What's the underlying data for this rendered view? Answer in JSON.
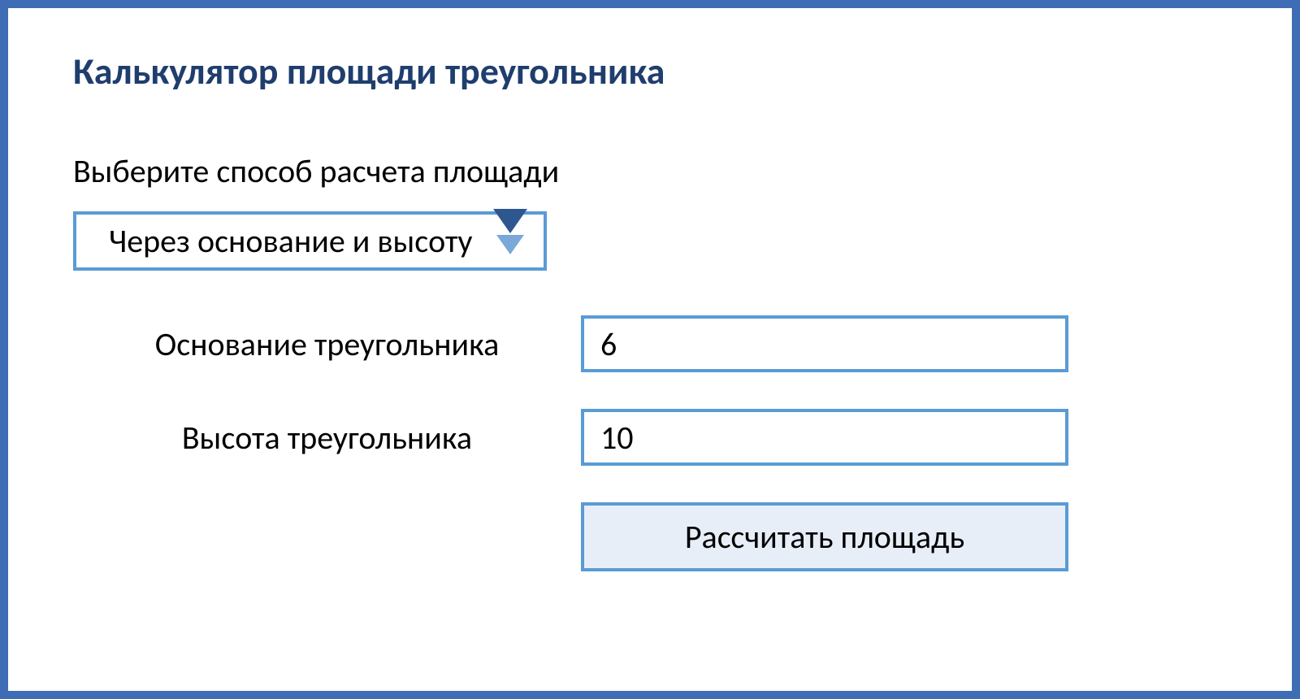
{
  "title": "Калькулятор площади треугольника",
  "method": {
    "label": "Выберите способ расчета площади",
    "selected": "Через основание и высоту"
  },
  "fields": {
    "base": {
      "label": "Основание треугольника",
      "value": "6"
    },
    "height": {
      "label": "Высота треугольника",
      "value": "10"
    }
  },
  "button": {
    "calculate": "Рассчитать площадь"
  },
  "colors": {
    "border": "#3e6db5",
    "accent": "#5a9bd5",
    "titleText": "#1f3e6e",
    "buttonBg": "#e8eef8"
  }
}
